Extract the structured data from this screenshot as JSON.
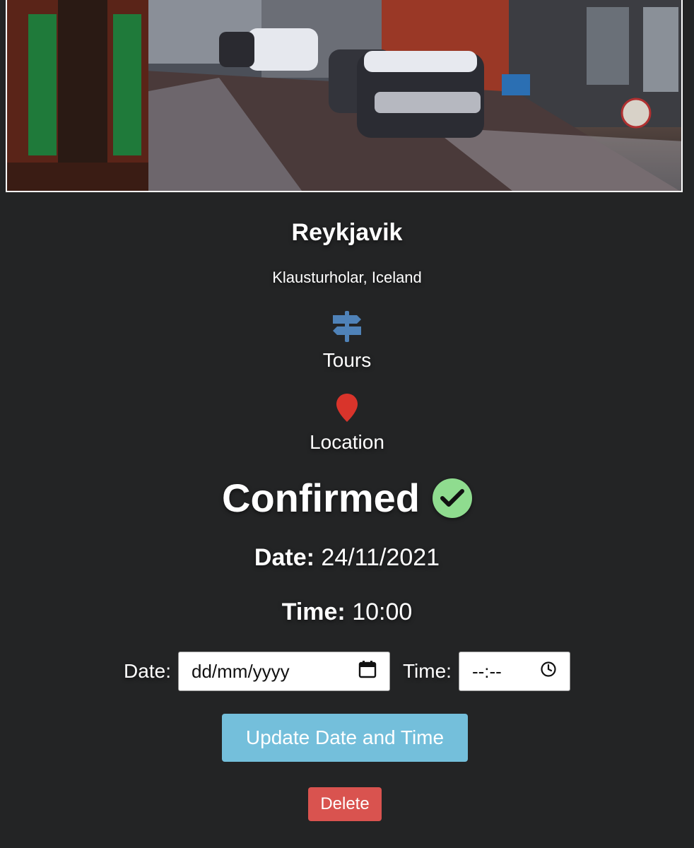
{
  "hero": {
    "alt": "Snowy street with parked cars"
  },
  "listing": {
    "title": "Reykjavik",
    "subtitle": "Klausturholar, Iceland",
    "category": {
      "icon": "signpost-icon",
      "label": "Tours",
      "color": "#4f82b8"
    },
    "location": {
      "icon": "map-pin-icon",
      "label": "Location",
      "color": "#d9342b"
    }
  },
  "status": {
    "text": "Confirmed",
    "icon": "check-circle-icon",
    "color": "#8fdc8f"
  },
  "booking": {
    "date_label": "Date:",
    "date_value": "24/11/2021",
    "time_label": "Time:",
    "time_value": "10:00"
  },
  "form": {
    "date_label": "Date:",
    "date_placeholder": "dd/mm/yyyy",
    "time_label": "Time:",
    "time_placeholder": "--:--",
    "update_button": "Update Date and Time",
    "delete_button": "Delete"
  },
  "colors": {
    "background": "#232425",
    "update": "#74bfdb",
    "delete": "#d9534f"
  }
}
